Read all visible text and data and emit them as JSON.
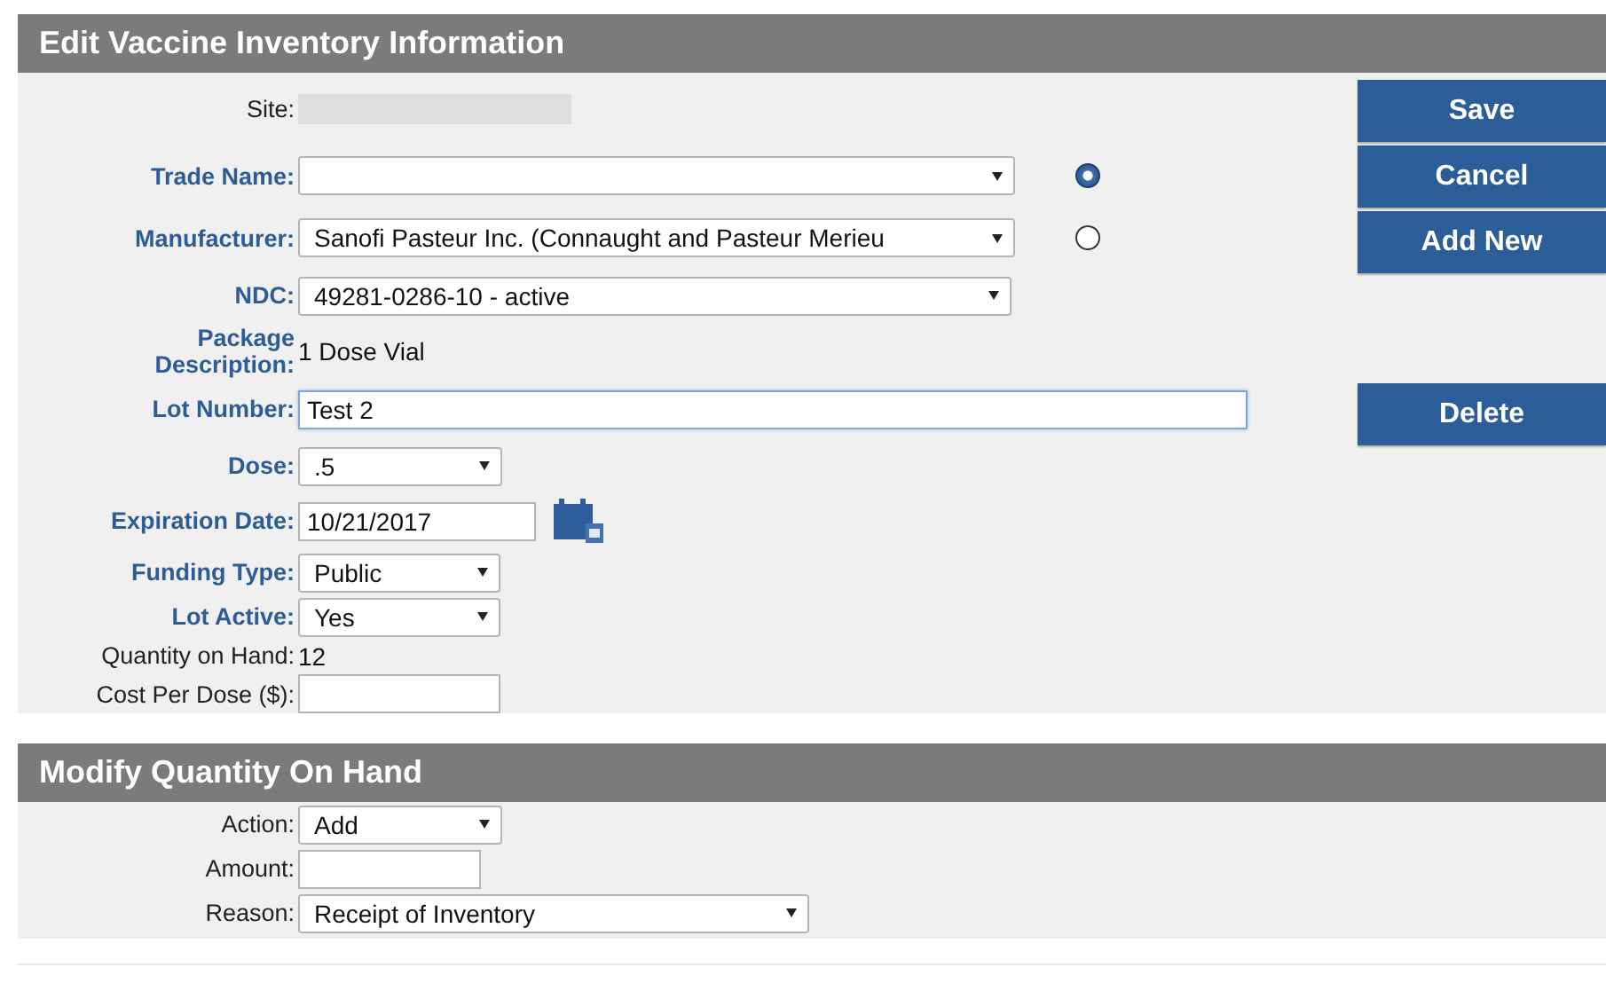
{
  "sections": [
    {
      "title": "Edit Vaccine Inventory Information",
      "fields": [
        {
          "label": "Site:",
          "kind": "redacted",
          "required": false
        },
        {
          "label": "Trade Name:",
          "kind": "select",
          "required": true,
          "selected": true
        },
        {
          "label": "Manufacturer:",
          "kind": "select",
          "value": "Sanofi Pasteur Inc. (Connaught and Pasteur Merieu",
          "required": true,
          "selected": false
        },
        {
          "label": "NDC:",
          "kind": "select",
          "value": "49281-0286-10 - active",
          "required": true
        },
        {
          "label": "Package Description:",
          "kind": "static",
          "value": "1 Dose Vial",
          "required": true
        },
        {
          "label": "Lot Number:",
          "kind": "input",
          "value": "Test 2",
          "required": true,
          "focused": true
        },
        {
          "label": "Dose:",
          "kind": "select",
          "value": ".5",
          "required": true
        },
        {
          "label": "Expiration Date:",
          "kind": "date",
          "value": "10/21/2017",
          "required": true
        },
        {
          "label": "Funding Type:",
          "kind": "select",
          "value": "Public",
          "required": true
        },
        {
          "label": "Lot Active:",
          "kind": "select",
          "value": "Yes",
          "required": true
        },
        {
          "label": "Quantity on Hand:",
          "kind": "static",
          "value": "12",
          "required": false
        },
        {
          "label": "Cost Per Dose ($):",
          "kind": "input",
          "required": false
        }
      ],
      "buttons": [
        "Save",
        "Cancel",
        "Add New",
        "Delete"
      ]
    },
    {
      "title": "Modify Quantity On Hand",
      "fields": [
        {
          "label": "Action:",
          "kind": "select",
          "value": "Add",
          "required": false
        },
        {
          "label": "Amount:",
          "kind": "input",
          "required": false
        },
        {
          "label": "Reason:",
          "kind": "select",
          "value": "Receipt of Inventory",
          "required": false
        }
      ]
    }
  ]
}
